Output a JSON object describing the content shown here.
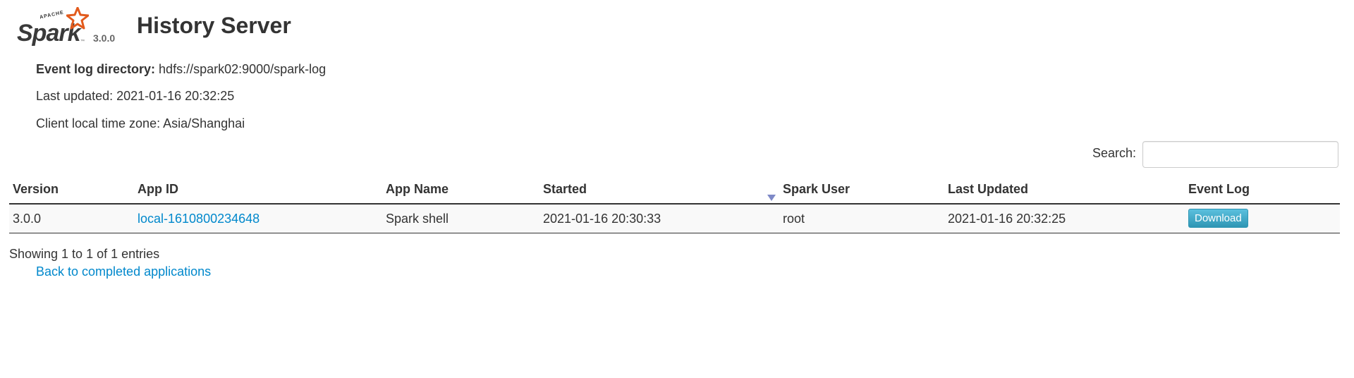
{
  "header": {
    "logo_text": "Spark",
    "logo_apache": "APACHE",
    "version": "3.0.0",
    "title": "History Server"
  },
  "info": {
    "log_dir_label": "Event log directory:",
    "log_dir_value": "hdfs://spark02:9000/spark-log",
    "last_updated": "Last updated: 2021-01-16 20:32:25",
    "timezone": "Client local time zone: Asia/Shanghai"
  },
  "search": {
    "label": "Search:",
    "value": "",
    "placeholder": ""
  },
  "table": {
    "columns": [
      "Version",
      "App ID",
      "App Name",
      "Started",
      "Spark User",
      "Last Updated",
      "Event Log"
    ],
    "sort_column": "Started",
    "sort_direction": "descending",
    "rows": [
      {
        "version": "3.0.0",
        "app_id": "local-1610800234648",
        "app_name": "Spark shell",
        "started": "2021-01-16 20:30:33",
        "spark_user": "root",
        "last_updated": "2021-01-16 20:32:25",
        "event_log_button": "Download"
      }
    ]
  },
  "footer": {
    "showing": "Showing 1 to 1 of 1 entries",
    "back_link": "Back to completed applications"
  },
  "colors": {
    "link": "#0088cc",
    "button": "#49afcd",
    "logo_star": "#e25a1c",
    "sort_arrow": "#7e89c7"
  },
  "icons": {
    "logo_star": "spark-star-icon",
    "sort": "sort-desc-icon"
  }
}
